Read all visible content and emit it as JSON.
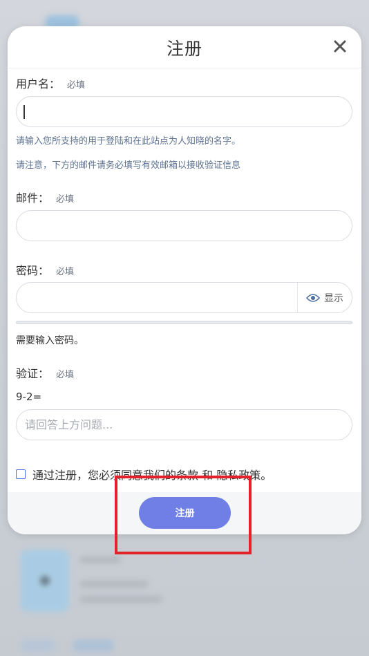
{
  "modal": {
    "title": "注册",
    "close_label": "✕"
  },
  "username": {
    "label": "用户名：",
    "required": "必填",
    "value": "",
    "hint1": "请输入您所支持的用于登陆和在此站点为人知晓的名字。",
    "hint2": "请注意，下方的邮件请务必填写有效邮箱以接收验证信息"
  },
  "email": {
    "label": "邮件：",
    "required": "必填",
    "value": ""
  },
  "password": {
    "label": "密码：",
    "required": "必填",
    "value": "",
    "show_label": "显示",
    "hint": "需要输入密码。"
  },
  "verify": {
    "label": "验证：",
    "required": "必填",
    "question": "9-2=",
    "placeholder": "请回答上方问题..."
  },
  "agree": {
    "prefix": "通过注册，您必须同意我们的",
    "terms": "条款",
    "and": "和",
    "privacy": "隐私政策",
    "suffix": "。"
  },
  "footer": {
    "submit_label": "注册"
  },
  "colors": {
    "accent": "#6f7fe6",
    "highlight": "#e4202d",
    "hint": "#5c7191"
  }
}
